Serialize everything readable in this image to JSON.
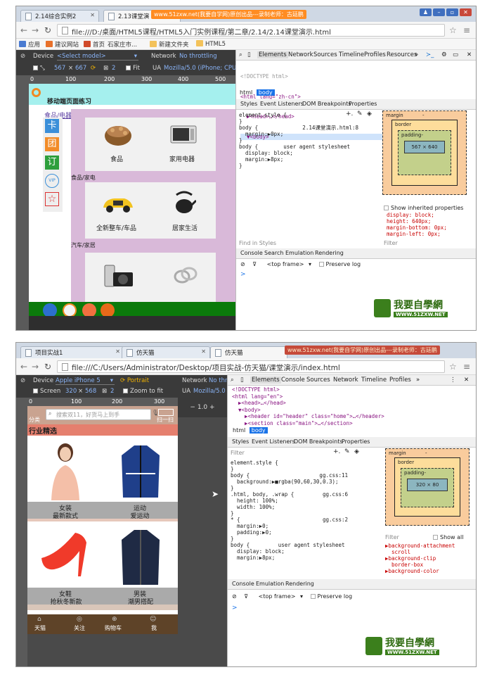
{
  "shot1": {
    "tabs": [
      "2.14综合实例2",
      "2.13课堂演"
    ],
    "banner": "www.51zxw.net(我要自学网)原创出品---录制老师：古廷鹏",
    "url": "file:///D:/桌面/HTML5课程/HTML5入门实例课程/第二章/2.14/2.14课堂演示.html",
    "bookmarks": [
      "应用",
      "建议网站",
      "首页",
      "石家庄市...",
      "新建文件夹",
      "HTML5"
    ],
    "device_label": "Device",
    "device_value": "<Select model>",
    "network_label": "Network",
    "network_value": "No throttling",
    "screen_w": "567",
    "screen_h": "667",
    "dpr": "2",
    "fit": "Fit",
    "ua_label": "UA",
    "ua_value": "Mozilla/5.0 (iPhone; CPU iPhon",
    "ruler": [
      "0",
      "100",
      "200",
      "300",
      "400",
      "500"
    ],
    "page_title": "移动端页面练习",
    "side_link": "食品/电器",
    "side_buttons": [
      "卡",
      "团",
      "订"
    ],
    "side_vip": "VIP",
    "section1_label": "食品/家电",
    "section2_label": "汽车/家居",
    "items": [
      "食品",
      "家用电器",
      "全新整车/车品",
      "居家生活"
    ],
    "footer_icons": [
      "apps-icon",
      "leaf-icon",
      "bag-icon",
      "user-icon"
    ],
    "dt_tabs": [
      "Elements",
      "Network",
      "Sources",
      "Timeline",
      "Profiles",
      "Resources"
    ],
    "dom_lines": [
      "<!DOCTYPE html>",
      "<html lang=\"zh-cn\">",
      "  ▶<head>…</head>",
      "  ▼<body>"
    ],
    "crumbs": [
      "html",
      "body"
    ],
    "style_tabs": [
      "Styles",
      "Event Listeners",
      "DOM Breakpoints",
      "Properties"
    ],
    "styles_text": "element.style {\n}\nbody {              2.14课堂演示.html:8\n  margin:▶0px;\n}\nbody {        user agent stylesheet\n  display: block;\n  margin:▶8px;\n}",
    "box_margin": "margin",
    "box_border": "border",
    "box_padding": "padding-",
    "box_size": "567 × 640",
    "box_dash": "-",
    "inherited_label": "Show inherited properties",
    "inherited_text": "display: block;\nheight: 640px;\nmargin-bottom: 0px;\nmargin-left: 0px;",
    "find_styles": "Find in Styles",
    "filter": "Filter",
    "console_tabs": [
      "Console",
      "Search",
      "Emulation",
      "Rendering"
    ],
    "console_frame": "<top frame>",
    "preserve_log": "Preserve log",
    "prompt": ">",
    "logo_cn": "我要自學網",
    "logo_url": "WWW.51ZXW.NET"
  },
  "shot2": {
    "tabs": [
      "项目实战1",
      "仿天猫",
      "仿天猫"
    ],
    "banner": "www.51zxw.net(我要自学网)原创出品---录制老师：古廷鹏",
    "url": "file:///C:/Users/Administrator/Desktop/项目实战-仿天猫/课堂演示/index.html",
    "device_label": "Device",
    "device_value": "Apple iPhone 5",
    "portrait": "Portrait",
    "network_label": "Network",
    "network_value": "No thro",
    "screen_label": "Screen",
    "screen_w": "320",
    "screen_h": "568",
    "dpr": "2",
    "zoom_fit": "Zoom to fit",
    "ua_label": "UA",
    "ua_value": "Mozilla/5.0 (iP",
    "zoom_value": "1.0",
    "ruler": [
      "0",
      "100",
      "200",
      "300"
    ],
    "search_placeholder": "搜索双11，好货马上到手",
    "cat_left": "分类",
    "scan": "扫一扫",
    "section_title": "行业精选",
    "products": [
      {
        "l1": "女装",
        "l2": "最新款式"
      },
      {
        "l1": "运动",
        "l2": "爱运动"
      },
      {
        "l1": "女鞋",
        "l2": "抢秋冬新款"
      },
      {
        "l1": "男装",
        "l2": "潮男搭配"
      }
    ],
    "nav": [
      "天猫",
      "关注",
      "购物车",
      "我"
    ],
    "dt_tabs": [
      "Elements",
      "Console",
      "Sources",
      "Network",
      "Timeline",
      "Profiles"
    ],
    "dom_text": "<!DOCTYPE html>\n<html lang=\"en\">\n  ▶<head>…</head>\n  ▼<body>\n    ▶<header id=\"header\" class=\"home\">…</header>\n    ▶<section class=\"main\">…</section>",
    "crumbs": [
      "html",
      "body"
    ],
    "style_tabs": [
      "Styles",
      "Event Listeners",
      "DOM Breakpoints",
      "Properties"
    ],
    "filter": "Filter",
    "styles_text": "element.style {\n}\nbody {                      gg.css:11\n  background:▶■rgba(90,60,30,0.3);\n}\n.html, body, .wrap {         gg.css:6\n  height: 100%;\n  width: 100%;\n}\n* {                          gg.css:2\n  margin:▶0;\n  padding:▶0;\n}\nbody {         user agent stylesheet\n  display: block;\n  margin:▶8px;",
    "box_margin": "margin",
    "box_border": "border",
    "box_padding": "padding-",
    "box_size": "320 × 80",
    "box_dash": "-",
    "filter2": "Filter",
    "show_all": "Show all",
    "computed_text": "▶background-attachment\n  scroll\n▶background-clip\n  border-box\n▶background-color",
    "console_tabs": [
      "Console",
      "Emulation",
      "Rendering"
    ],
    "console_frame": "<top frame>",
    "preserve_log": "Preserve log",
    "prompt": ">",
    "logo_cn": "我要自學網",
    "logo_url": "WWW.51ZXW.NET"
  }
}
